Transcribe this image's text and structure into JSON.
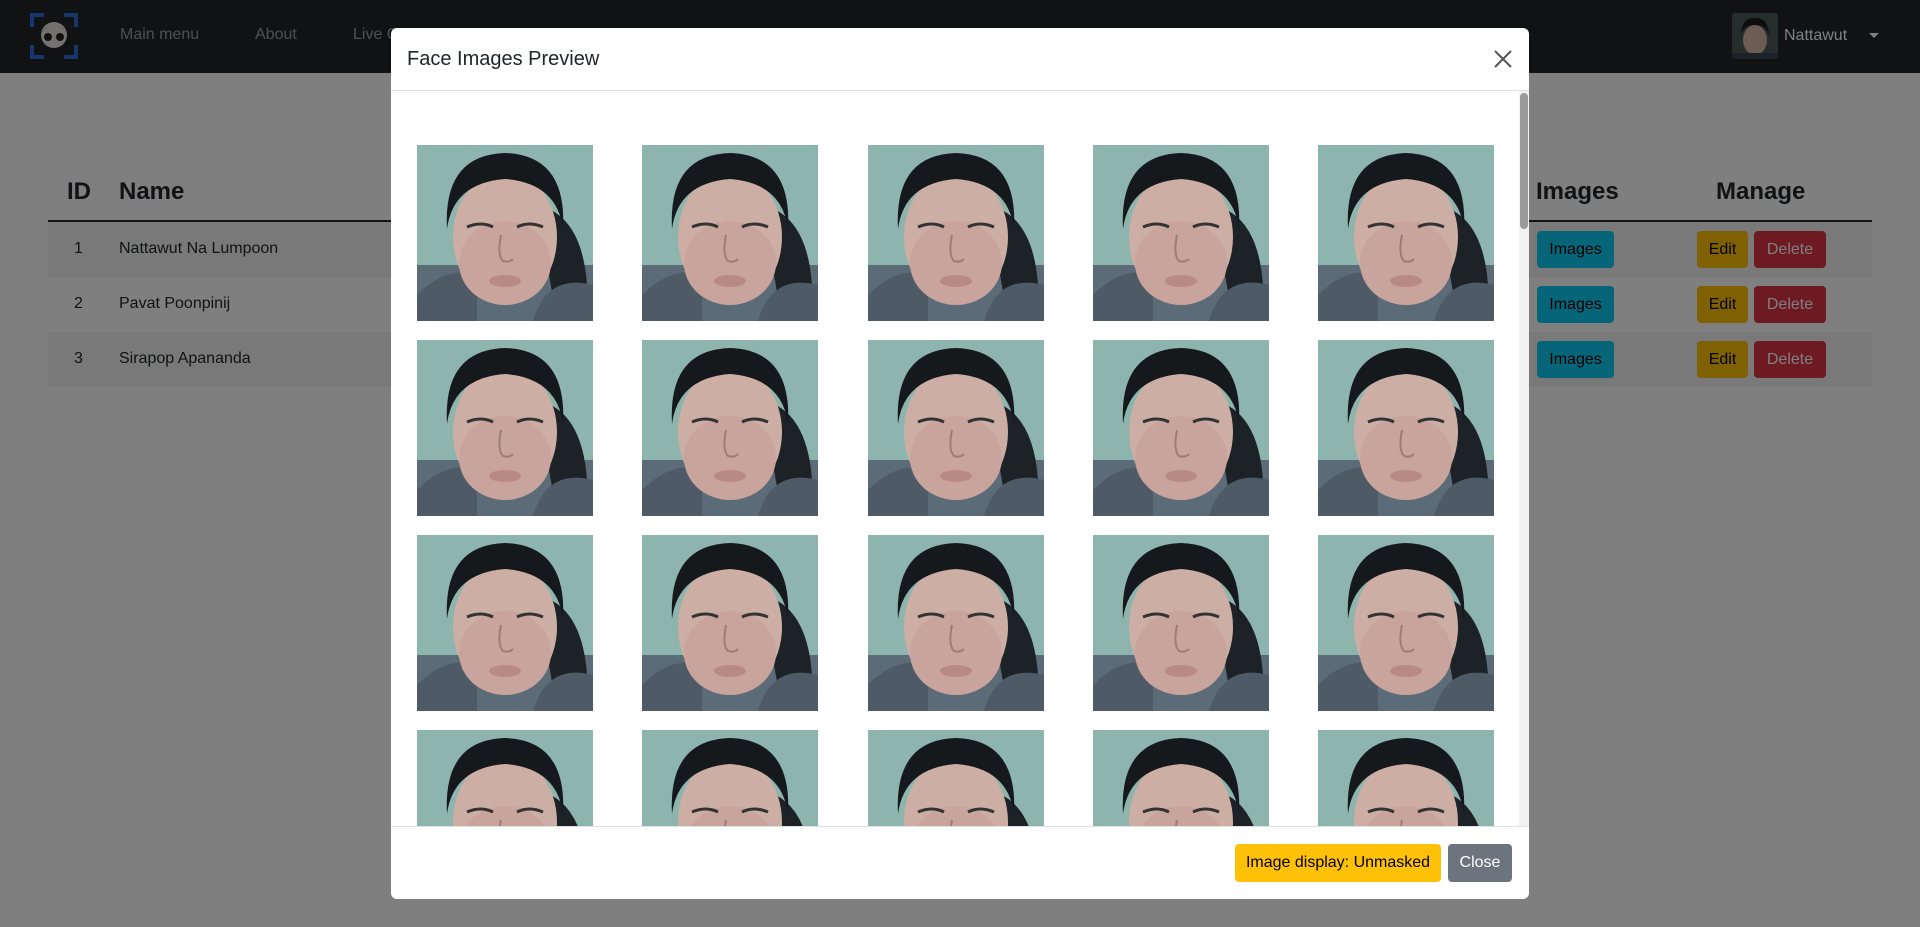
{
  "navbar": {
    "items": [
      {
        "label": "Main menu"
      },
      {
        "label": "About"
      },
      {
        "label": "Live C"
      }
    ],
    "user": {
      "name": "Nattawut"
    }
  },
  "table": {
    "headers": {
      "id": "ID",
      "name": "Name",
      "images": "Images",
      "manage": "Manage"
    },
    "rows": [
      {
        "id": "1",
        "name": "Nattawut Na Lumpoon",
        "images_label": "Images",
        "edit_label": "Edit",
        "delete_label": "Delete"
      },
      {
        "id": "2",
        "name": "Pavat Poonpinij",
        "images_label": "Images",
        "edit_label": "Edit",
        "delete_label": "Delete"
      },
      {
        "id": "3",
        "name": "Sirapop Apananda",
        "images_label": "Images",
        "edit_label": "Edit",
        "delete_label": "Delete"
      }
    ]
  },
  "modal": {
    "title": "Face Images Preview",
    "footer": {
      "display_label": "Image display: Unmasked",
      "close_label": "Close"
    }
  }
}
